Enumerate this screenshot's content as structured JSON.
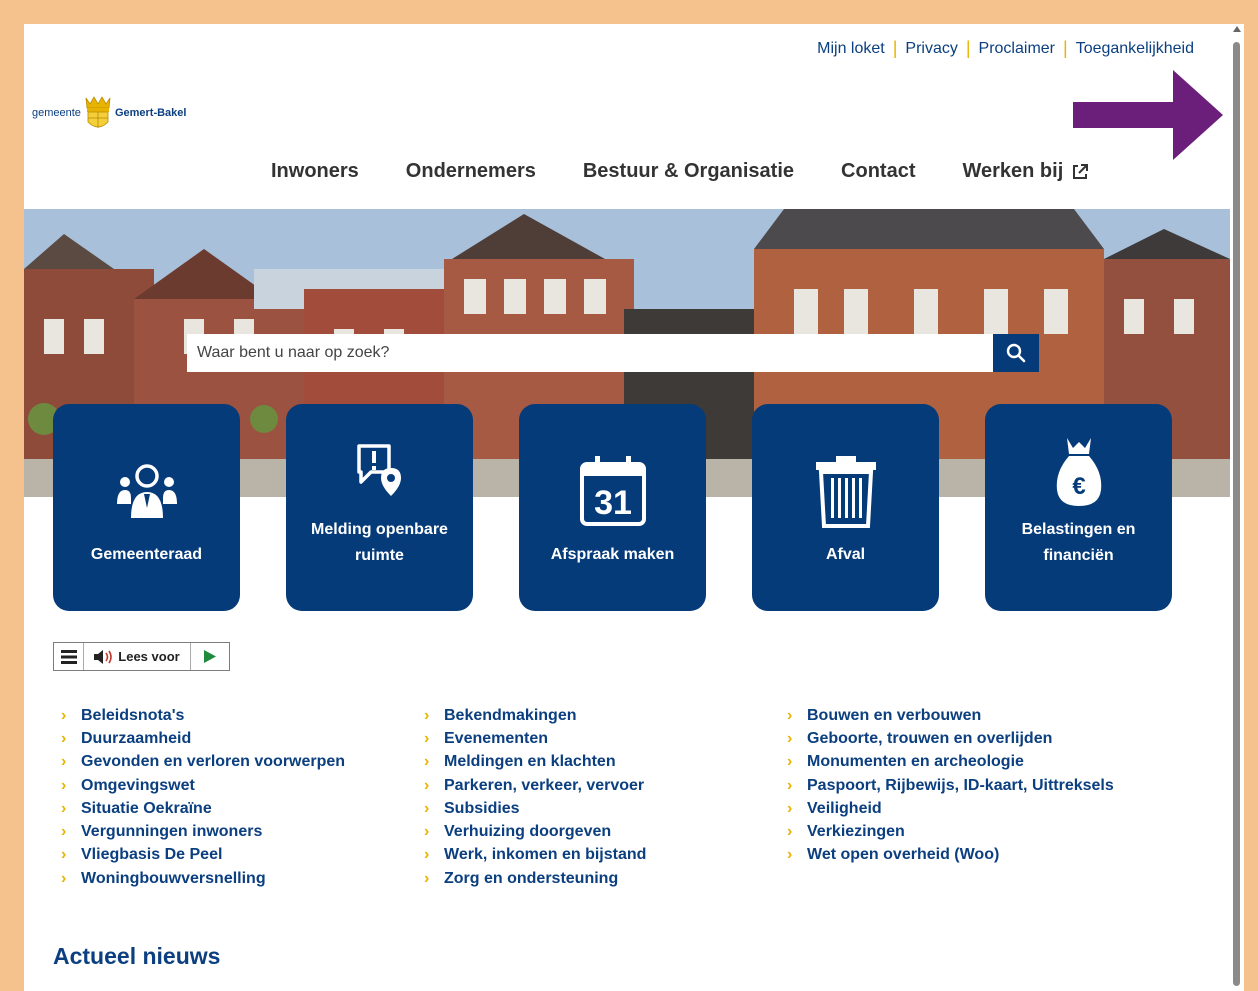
{
  "toplinks": [
    "Mijn loket",
    "Privacy",
    "Proclaimer",
    "Toegankelijkheid"
  ],
  "logo": {
    "prefix": "gemeente",
    "name": "Gemert-Bakel"
  },
  "nav": [
    "Inwoners",
    "Ondernemers",
    "Bestuur & Organisatie",
    "Contact",
    "Werken bij"
  ],
  "search": {
    "placeholder": "Waar bent u naar op zoek?"
  },
  "tiles": [
    {
      "label": "Gemeenteraad",
      "icon": "council-icon"
    },
    {
      "label": "Melding openbare ruimte",
      "icon": "report-location-icon"
    },
    {
      "label": "Afspraak maken",
      "icon": "calendar-icon",
      "calendar_day": "31"
    },
    {
      "label": "Afval",
      "icon": "trash-bin-icon"
    },
    {
      "label": "Belastingen en financiën",
      "icon": "money-bag-icon",
      "symbol": "€"
    }
  ],
  "reader": {
    "label": "Lees voor"
  },
  "links": {
    "col1": [
      "Beleidsnota's",
      "Duurzaamheid",
      "Gevonden en verloren voorwerpen",
      "Omgevingswet",
      "Situatie Oekraïne",
      "Vergunningen inwoners",
      "Vliegbasis De Peel",
      "Woningbouwversnelling"
    ],
    "col2": [
      "Bekendmakingen",
      "Evenementen",
      "Meldingen en klachten",
      "Parkeren, verkeer, vervoer",
      "Subsidies",
      "Verhuizing doorgeven",
      "Werk, inkomen en bijstand",
      "Zorg en ondersteuning"
    ],
    "col3": [
      "Bouwen en verbouwen",
      "Geboorte, trouwen en overlijden",
      "Monumenten en archeologie",
      "Paspoort, Rijbewijs, ID-kaart, Uittreksels",
      "Veiligheid",
      "Verkiezingen",
      "Wet open overheid (Woo)"
    ]
  },
  "news_heading": "Actueel nieuws",
  "colors": {
    "brand": "#063b7a",
    "accent": "#e8b400",
    "annotation": "#6b1f7a",
    "frame": "#f5c28e"
  }
}
